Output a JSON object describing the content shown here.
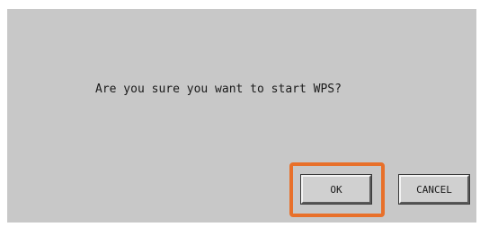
{
  "dialog": {
    "message": "Are you sure you want to start WPS?",
    "ok_label": "OK",
    "cancel_label": "CANCEL",
    "highlight_color": "#e8702a",
    "background_color": "#c8c8c8"
  }
}
